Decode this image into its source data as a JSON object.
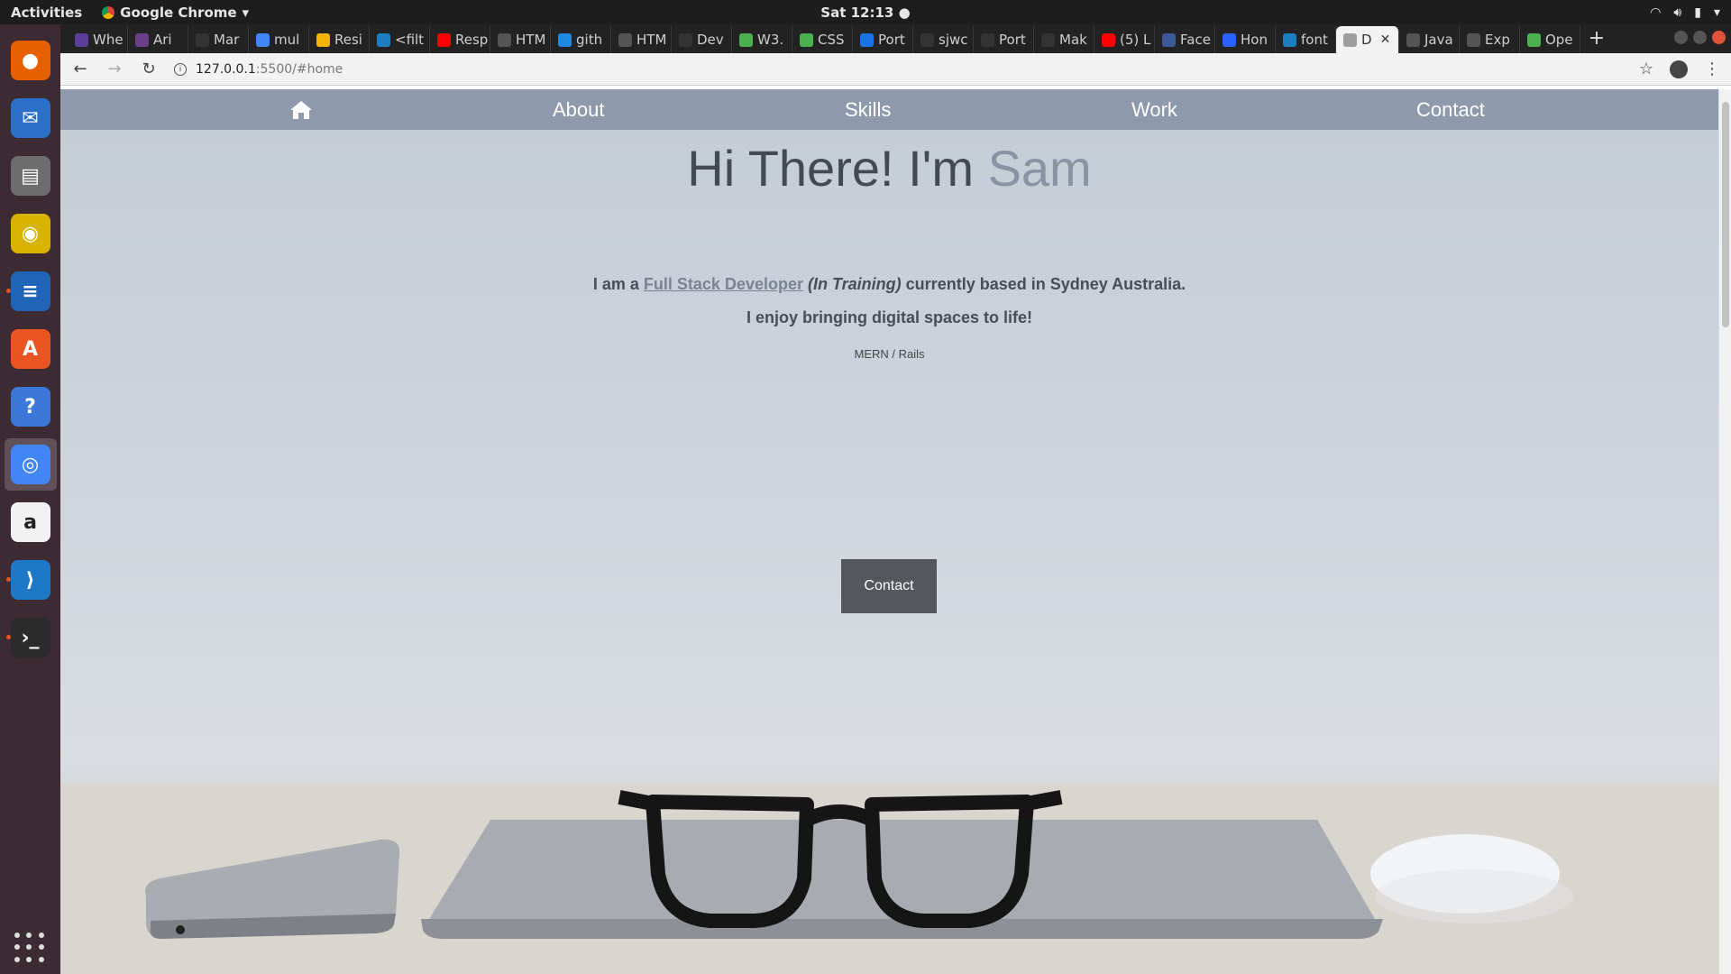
{
  "topbar": {
    "activities": "Activities",
    "app_name": "Google Chrome",
    "clock": "Sat 12:13"
  },
  "dock": {
    "items": [
      {
        "name": "firefox",
        "color": "#e66000"
      },
      {
        "name": "thunderbird",
        "color": "#2a6fc9"
      },
      {
        "name": "files",
        "color": "#6d6d6d"
      },
      {
        "name": "rhythmbox",
        "color": "#d8b400"
      },
      {
        "name": "libreoffice-writer",
        "color": "#1f64b7"
      },
      {
        "name": "ubuntu-software",
        "color": "#e95420"
      },
      {
        "name": "help",
        "color": "#3b78d8"
      },
      {
        "name": "chrome",
        "color": "#4285f4"
      },
      {
        "name": "amazon",
        "color": "#f2f2f2"
      },
      {
        "name": "vscode",
        "color": "#1e78c8"
      },
      {
        "name": "terminal",
        "color": "#2b2b2b"
      }
    ]
  },
  "browser": {
    "tabs": [
      {
        "label": "Whe",
        "color": "#5c3d99"
      },
      {
        "label": "Ari",
        "color": "#6b3f8a"
      },
      {
        "label": "Mar",
        "color": "#333333"
      },
      {
        "label": "mul",
        "color": "#4285f4"
      },
      {
        "label": "Resi",
        "color": "#f4b400"
      },
      {
        "label": "<filt",
        "color": "#1b7ec2"
      },
      {
        "label": "Resp",
        "color": "#ff0000"
      },
      {
        "label": "HTM",
        "color": "#555555"
      },
      {
        "label": "gith",
        "color": "#1e88e5"
      },
      {
        "label": "HTM",
        "color": "#555555"
      },
      {
        "label": "Dev",
        "color": "#333333"
      },
      {
        "label": "W3.",
        "color": "#4caf50"
      },
      {
        "label": "CSS",
        "color": "#4caf50"
      },
      {
        "label": "Port",
        "color": "#1a73e8"
      },
      {
        "label": "sjwc",
        "color": "#333333"
      },
      {
        "label": "Port",
        "color": "#333333"
      },
      {
        "label": "Mak",
        "color": "#333333"
      },
      {
        "label": "(5) L",
        "color": "#ff0000"
      },
      {
        "label": "Face",
        "color": "#3b5998"
      },
      {
        "label": "Hon",
        "color": "#2962ff"
      },
      {
        "label": "font",
        "color": "#1b7ec2"
      },
      {
        "label": "D",
        "color": "#9e9e9e",
        "active": true
      },
      {
        "label": "Java",
        "color": "#555555"
      },
      {
        "label": "Exp",
        "color": "#555555"
      },
      {
        "label": "Ope",
        "color": "#4caf50"
      }
    ],
    "url_host": "127.0.0.1",
    "url_path": ":5500/#home"
  },
  "site": {
    "nav": {
      "about": "About",
      "skills": "Skills",
      "work": "Work",
      "contact": "Contact"
    },
    "hero": {
      "greeting": "Hi There! I'm ",
      "name": "Sam"
    },
    "intro": {
      "prefix": "I am a ",
      "role_link": "Full Stack Developer",
      "training": "(In Training)",
      "suffix": " currently based in Sydney Australia.",
      "line2": "I enjoy bringing digital spaces to life!",
      "stack": "MERN / Rails"
    },
    "contact_button": "Contact"
  }
}
